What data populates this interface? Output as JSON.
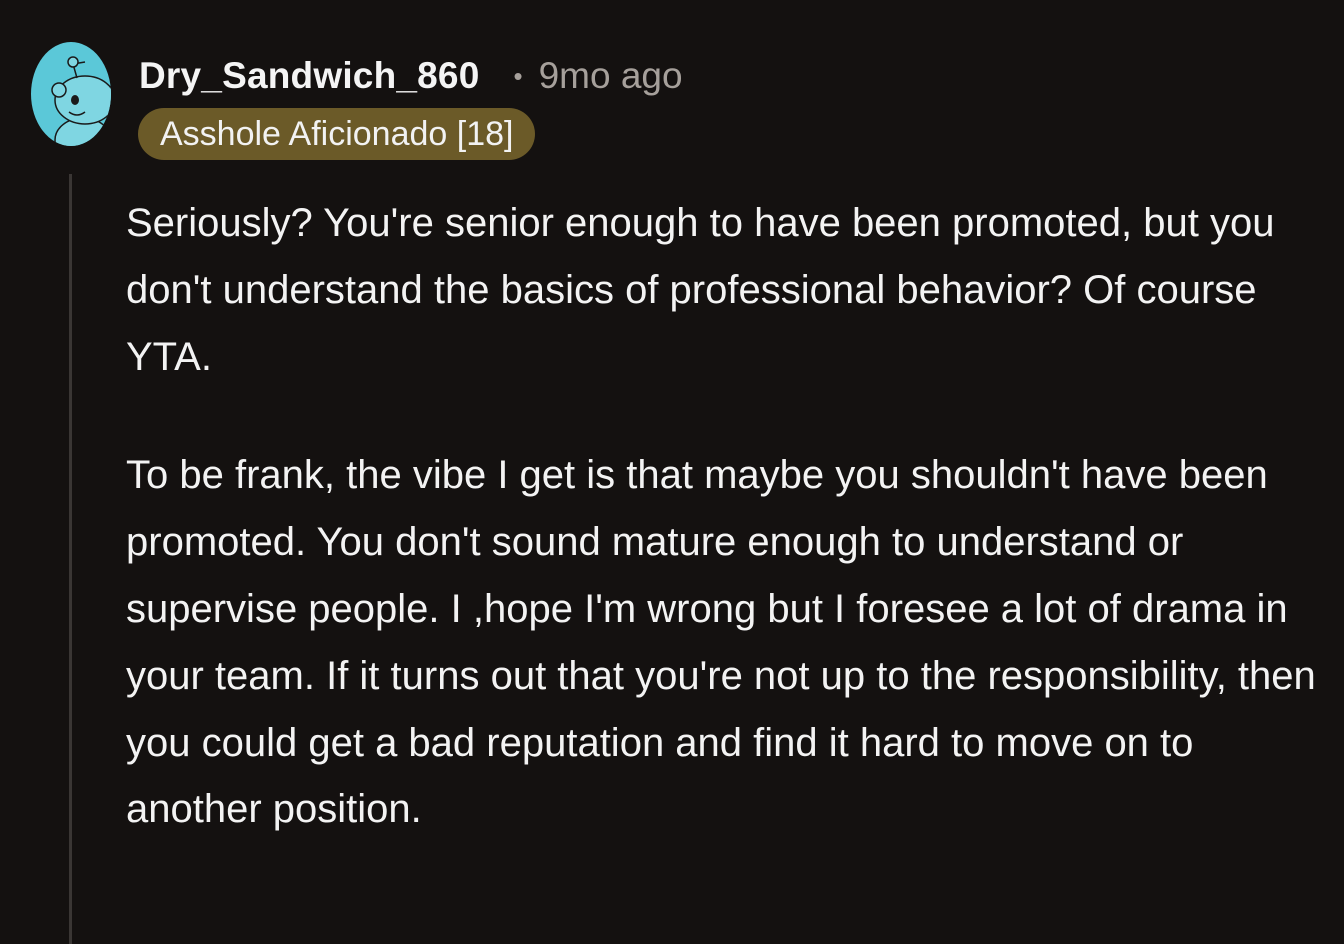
{
  "comment": {
    "username": "Dry_Sandwich_860",
    "separator": "•",
    "timestamp": "9mo ago",
    "flair": "Asshole Aficionado [18]",
    "paragraphs": [
      "Seriously? You're senior enough to have been promoted, but you don't understand the basics of professional behavior? Of course YTA.",
      "To be frank, the vibe I get is that maybe you shouldn't have been promoted. You don't sound mature enough to understand or supervise people. I ,hope I'm wrong but I foresee a lot of drama in your team. If it turns out that you're not up to the responsibility, then you could get a bad reputation and find it hard to move on to another position."
    ]
  },
  "colors": {
    "background": "#141110",
    "avatar": "#5bc8d8",
    "flair_background": "#6b5a28",
    "meta_text": "#a6a09b",
    "thread_line": "#3a3634"
  },
  "icons": {
    "avatar": "snoo-avatar-icon"
  }
}
